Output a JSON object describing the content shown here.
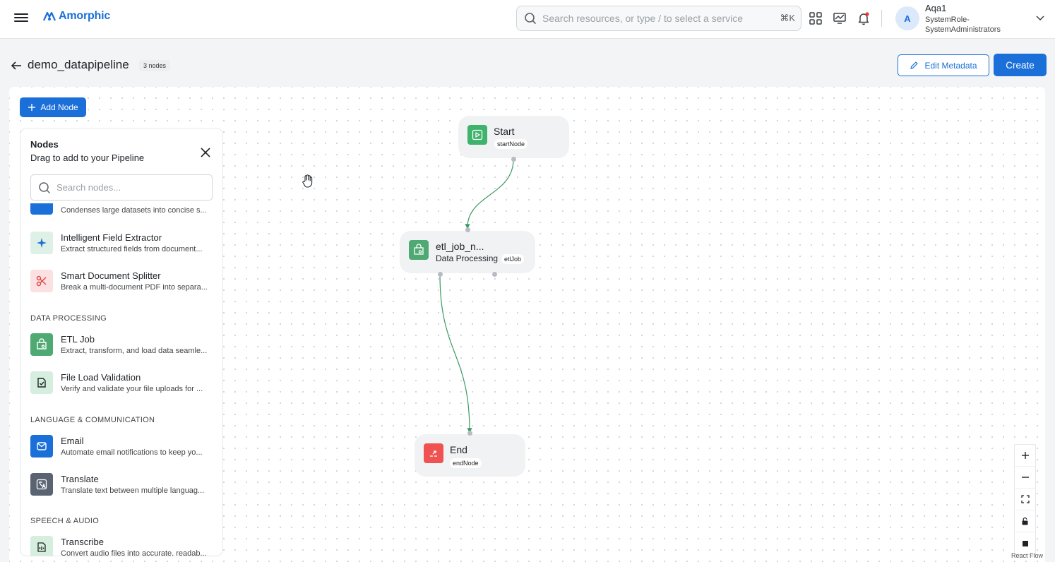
{
  "app": {
    "name": "Amorphic"
  },
  "header": {
    "search_placeholder": "Search resources, or type / to select a service",
    "search_shortcut": "⌘K",
    "icons": [
      "apps-grid-icon",
      "monitor-chart-icon",
      "bell-icon"
    ],
    "user": {
      "initial": "A",
      "name": "Aqa1",
      "role": "SystemRole-SystemAdministrators"
    }
  },
  "page": {
    "title": "demo_datapipeline",
    "node_count_badge": "3 nodes",
    "edit_metadata_label": "Edit Metadata",
    "create_label": "Create",
    "add_node_label": "Add Node"
  },
  "panel": {
    "title": "Nodes",
    "subtitle": "Drag to add to your Pipeline",
    "search_placeholder": "Search nodes...",
    "partial_item_desc": "Condenses large datasets into concise s...",
    "items_ai": [
      {
        "name": "Intelligent Field Extractor",
        "desc": "Extract structured fields from document...",
        "icon": "sparkle-icon",
        "color": "#1b6fd8",
        "bg": "#dff0e6"
      },
      {
        "name": "Smart Document Splitter",
        "desc": "Break a multi-document PDF into separa...",
        "icon": "scissors-icon",
        "color": "#e04848",
        "bg": "#fbe1e1"
      }
    ],
    "section_data_processing": "DATA PROCESSING",
    "items_data": [
      {
        "name": "ETL Job",
        "desc": "Extract, transform, and load data seamle...",
        "icon": "etl-bag-icon",
        "color": "#ffffff",
        "bg": "#4eaa72"
      },
      {
        "name": "File Load Validation",
        "desc": "Verify and validate your file uploads for ...",
        "icon": "file-check-icon",
        "color": "#2f7a4c",
        "bg": "#d6eedd"
      }
    ],
    "section_language": "LANGUAGE & COMMUNICATION",
    "items_language": [
      {
        "name": "Email",
        "desc": "Automate email notifications to keep yo...",
        "icon": "mail-icon",
        "color": "#ffffff",
        "bg": "#1b6fd8"
      },
      {
        "name": "Translate",
        "desc": "Translate text between multiple languag...",
        "icon": "translate-icon",
        "color": "#ffffff",
        "bg": "#5a6372"
      }
    ],
    "section_speech": "SPEECH & AUDIO",
    "items_speech": [
      {
        "name": "Transcribe",
        "desc": "Convert audio files into accurate, readab...",
        "icon": "transcribe-icon",
        "color": "#2f7a4c",
        "bg": "#d6eedd"
      }
    ]
  },
  "flow": {
    "nodes": [
      {
        "id": "start",
        "label": "Start",
        "type_tag": "startNode",
        "icon": "play-icon",
        "color": "#3fb26b"
      },
      {
        "id": "etl",
        "label": "etl_job_n...",
        "subtitle": "Data Processing",
        "type_tag": "etlJob",
        "icon": "etl-bag-icon",
        "color": "#4eaa72"
      },
      {
        "id": "end",
        "label": "End",
        "type_tag": "endNode",
        "icon": "exit-icon",
        "color": "#f05252"
      }
    ],
    "edges": [
      {
        "from": "start",
        "to": "etl"
      },
      {
        "from": "etl",
        "to": "end"
      }
    ],
    "edge_color": "#3a9a62",
    "controls": [
      "zoom-in",
      "zoom-out",
      "fit-view",
      "lock",
      "toggle-minimap"
    ],
    "attribution": "React Flow"
  }
}
